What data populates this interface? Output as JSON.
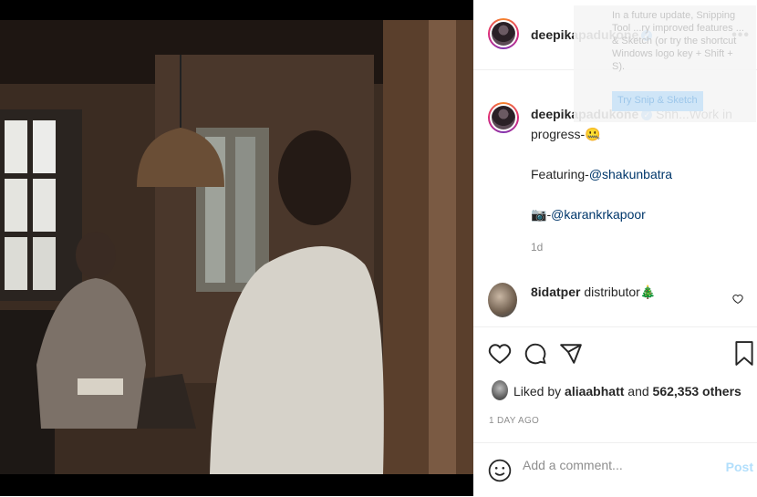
{
  "post": {
    "username": "deepikapadukone",
    "verified_icon": "verified-badge-icon",
    "more_icon": "more-options-icon",
    "caption_text": "Shh...Work in progress-",
    "caption_lines": [
      "Featuring-",
      "@shakunbatra",
      "-",
      "@karankrkapoor"
    ],
    "caption_emoji_1": "🤐",
    "caption_emoji_2": "📷",
    "time_ago": "1d"
  },
  "comment": {
    "username": "8idatper",
    "text": "distributor",
    "emoji": "🎄"
  },
  "likes": {
    "prefix": "Liked by",
    "user": "aliaabhatt",
    "and": "and",
    "count": "562,353 others"
  },
  "timestamp": "1 DAY AGO",
  "add_comment": {
    "placeholder": "Add a comment...",
    "post_label": "Post"
  },
  "overlay": {
    "snipping_text": "In a future update, Snipping Tool ...ry improved features ... & Sketch (or try the shortcut Windows logo key + Shift + S).",
    "snipping_button": "Try Snip & Sketch"
  },
  "colors": {
    "link": "#00376b",
    "post_disabled": "#b2dffc",
    "verified": "#3897f0",
    "muted": "#8e8e8e"
  }
}
